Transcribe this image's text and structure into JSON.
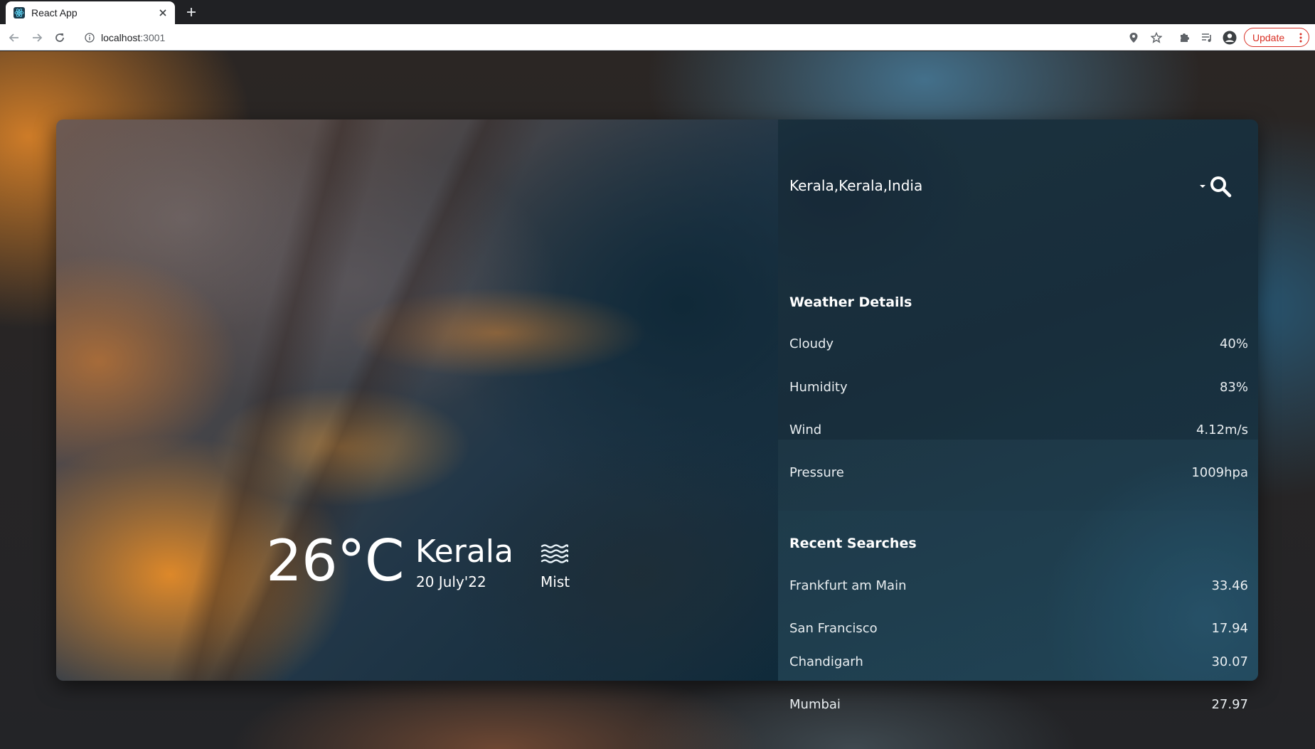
{
  "browser": {
    "tab_title": "React App",
    "url_host": "localhost",
    "url_port": ":3001",
    "update_label": "Update"
  },
  "weather": {
    "temperature": "26°C",
    "city": "Kerala",
    "date": "20 July'22",
    "condition": "Mist",
    "condition_icon": "mist-icon"
  },
  "search": {
    "value": "Kerala,Kerala,India"
  },
  "details": {
    "title": "Weather Details",
    "rows": [
      {
        "label": "Cloudy",
        "value": "40%"
      },
      {
        "label": "Humidity",
        "value": "83%"
      },
      {
        "label": "Wind",
        "value": "4.12m/s"
      },
      {
        "label": "Pressure",
        "value": "1009hpa"
      }
    ]
  },
  "recent": {
    "title": "Recent Searches",
    "rows": [
      {
        "label": "Frankfurt am Main",
        "value": "33.46"
      },
      {
        "label": "San Francisco",
        "value": "17.94"
      },
      {
        "label": "Chandigarh",
        "value": "30.07"
      },
      {
        "label": "Mumbai",
        "value": "27.97"
      }
    ]
  },
  "colors": {
    "panel": "#1d3543",
    "accent_orange": "#e68c28",
    "update_red": "#d93025"
  }
}
